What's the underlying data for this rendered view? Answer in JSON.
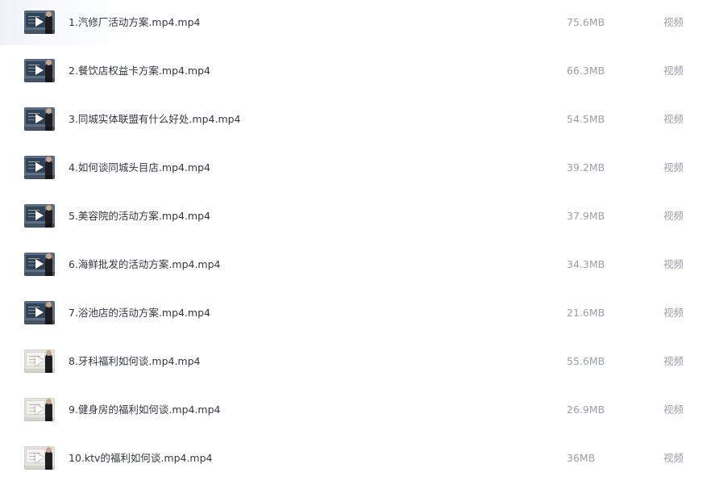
{
  "files": [
    {
      "name": "1.汽修厂活动方案.mp4.mp4",
      "size": "75.6MB",
      "type": "视频",
      "thumb_style": "dark"
    },
    {
      "name": "2.餐饮店权益卡方案.mp4.mp4",
      "size": "66.3MB",
      "type": "视频",
      "thumb_style": "dark"
    },
    {
      "name": "3.同城实体联盟有什么好处.mp4.mp4",
      "size": "54.5MB",
      "type": "视频",
      "thumb_style": "dark"
    },
    {
      "name": "4.如何谈同城头目店.mp4.mp4",
      "size": "39.2MB",
      "type": "视频",
      "thumb_style": "dark"
    },
    {
      "name": "5.美容院的活动方案.mp4.mp4",
      "size": "37.9MB",
      "type": "视频",
      "thumb_style": "dark"
    },
    {
      "name": "6.海鲜批发的活动方案.mp4.mp4",
      "size": "34.3MB",
      "type": "视频",
      "thumb_style": "dark"
    },
    {
      "name": "7.浴池店的活动方案.mp4.mp4",
      "size": "21.6MB",
      "type": "视频",
      "thumb_style": "dark"
    },
    {
      "name": "8.牙科福利如何谈.mp4.mp4",
      "size": "55.6MB",
      "type": "视频",
      "thumb_style": "light"
    },
    {
      "name": "9.健身房的福利如何谈.mp4.mp4",
      "size": "26.9MB",
      "type": "视频",
      "thumb_style": "light"
    },
    {
      "name": "10.ktv的福利如何谈.mp4.mp4",
      "size": "36MB",
      "type": "视频",
      "thumb_style": "light"
    }
  ],
  "thumb_icon": "video-thumbnail-play-icon",
  "colors": {
    "filename_text": "#33383f",
    "meta_text": "#9aa0a8",
    "first_row_highlight": "#eef2f8"
  }
}
